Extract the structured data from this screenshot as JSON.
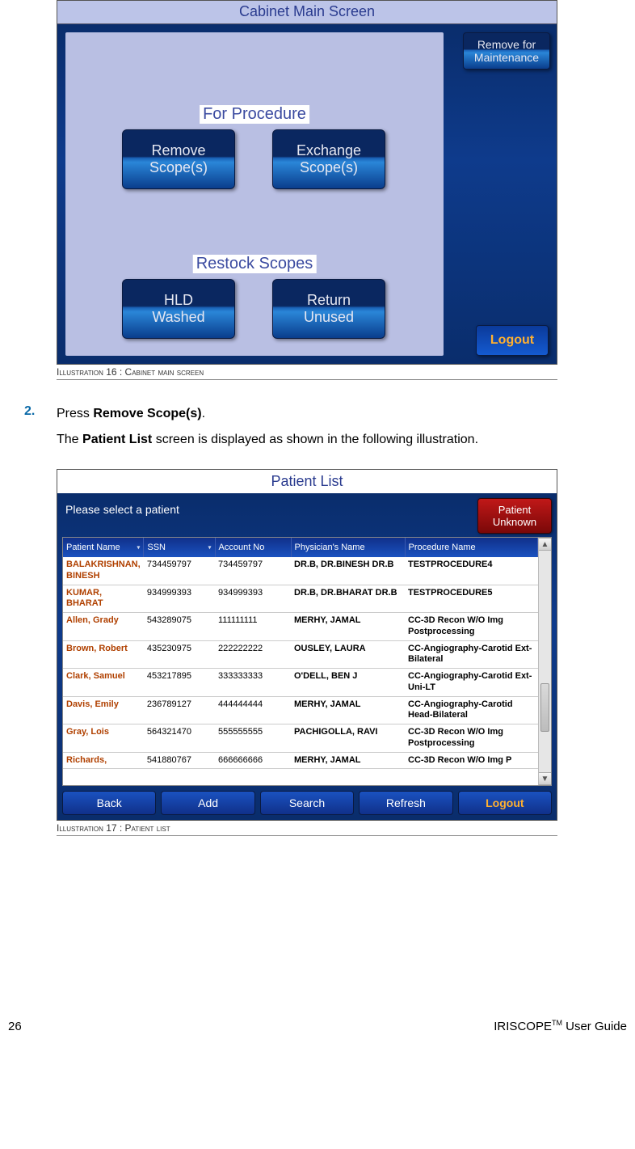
{
  "cabinet": {
    "title": "Cabinet Main Screen",
    "for_procedure": "For Procedure",
    "remove_scopes": "Remove\nScope(s)",
    "exchange_scopes": "Exchange\nScope(s)",
    "restock_scopes": "Restock Scopes",
    "hld_washed": "HLD\nWashed",
    "return_unused": "Return\nUnused",
    "remove_maint": "Remove for\nMaintenance",
    "logout": "Logout"
  },
  "ill16": "Illustration 16 : Cabinet main screen",
  "step": {
    "num": "2.",
    "line1a": "Press ",
    "line1b": "Remove Scope(s)",
    "line1c": ".",
    "line2a": "The ",
    "line2b": "Patient List",
    "line2c": " screen is displayed as shown in the following illustration."
  },
  "patient_list": {
    "title": "Patient List",
    "prompt": "Please select a patient",
    "unknown": "Patient\nUnknown",
    "headers": {
      "name": "Patient Name",
      "ssn": "SSN",
      "acct": "Account No",
      "phys": "Physician's Name",
      "proc": "Procedure Name"
    },
    "rows": [
      {
        "name": "BALAKRISHNAN, BINESH",
        "ssn": "734459797",
        "acct": "734459797",
        "phys": "DR.B, DR.BINESH DR.B",
        "proc": "TESTPROCEDURE4"
      },
      {
        "name": "KUMAR, BHARAT",
        "ssn": "934999393",
        "acct": "934999393",
        "phys": "DR.B, DR.BHARAT DR.B",
        "proc": "TESTPROCEDURE5"
      },
      {
        "name": "Allen, Grady",
        "ssn": "543289075",
        "acct": "111111111",
        "phys": "MERHY, JAMAL",
        "proc": "CC-3D Recon W/O Img Postprocessing"
      },
      {
        "name": "Brown, Robert",
        "ssn": "435230975",
        "acct": "222222222",
        "phys": "OUSLEY, LAURA",
        "proc": "CC-Angiography-Carotid Ext-Bilateral"
      },
      {
        "name": "Clark, Samuel",
        "ssn": "453217895",
        "acct": "333333333",
        "phys": "O'DELL, BEN J",
        "proc": "CC-Angiography-Carotid Ext-Uni-LT"
      },
      {
        "name": "Davis, Emily",
        "ssn": "236789127",
        "acct": "444444444",
        "phys": "MERHY, JAMAL",
        "proc": "CC-Angiography-Carotid Head-Bilateral"
      },
      {
        "name": "Gray, Lois",
        "ssn": "564321470",
        "acct": "555555555",
        "phys": "PACHIGOLLA, RAVI",
        "proc": "CC-3D Recon W/O Img Postprocessing"
      },
      {
        "name": "Richards,",
        "ssn": "541880767",
        "acct": "666666666",
        "phys": "MERHY, JAMAL",
        "proc": "CC-3D Recon W/O Img P"
      }
    ],
    "footer": {
      "back": "Back",
      "add": "Add",
      "search": "Search",
      "refresh": "Refresh",
      "logout": "Logout"
    }
  },
  "ill17": "Illustration 17 : Patient list",
  "footer": {
    "page": "26",
    "brand": "IRISCOPE",
    "tm": "TM",
    "guide": " User Guide"
  }
}
